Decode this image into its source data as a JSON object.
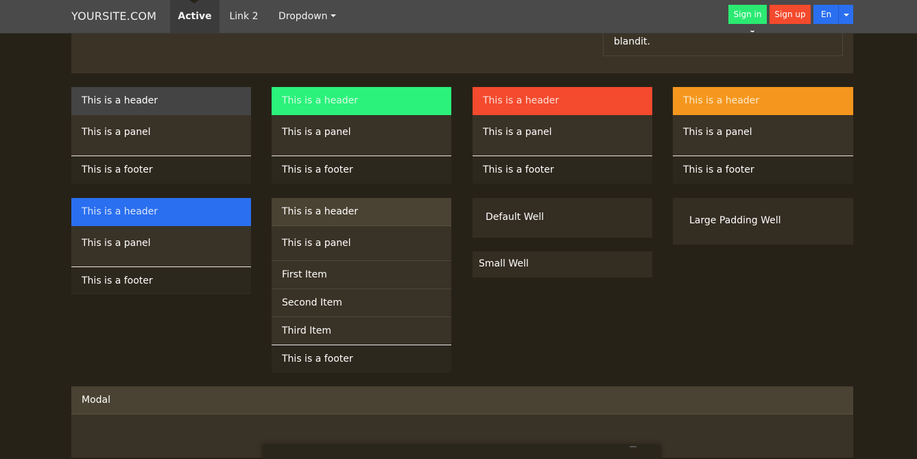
{
  "navbar": {
    "brand": "YOURSITE.COM",
    "items": [
      {
        "label": "Active"
      },
      {
        "label": "Link 2"
      },
      {
        "label": "Dropdown"
      }
    ],
    "sign_in": "Sign in",
    "sign_up": "Sign up",
    "language": "En"
  },
  "top": {
    "well_text": "blandit."
  },
  "panels": {
    "gray": {
      "header": "This is a header",
      "body": "This is a panel",
      "footer": "This is a footer"
    },
    "green": {
      "header": "This is a header",
      "body": "This is a panel",
      "footer": "This is a footer"
    },
    "red": {
      "header": "This is a header",
      "body": "This is a panel",
      "footer": "This is a footer"
    },
    "orange": {
      "header": "This is a header",
      "body": "This is a panel",
      "footer": "This is a footer"
    },
    "blue": {
      "header": "This is a header",
      "body": "This is a panel",
      "footer": "This is a footer"
    },
    "list": {
      "header": "This is a header",
      "body": "This is a panel",
      "items": [
        "First Item",
        "Second Item",
        "Third Item"
      ],
      "footer": "This is a footer"
    }
  },
  "wells": {
    "default": "Default Well",
    "small": "Small Well",
    "large": "Large Padding Well"
  },
  "modal": {
    "title": "Modal"
  },
  "colors": {
    "green": "#2bf27a",
    "red": "#f44a2d",
    "orange": "#f5971e",
    "blue": "#2a6ff0",
    "background": "#272218"
  }
}
